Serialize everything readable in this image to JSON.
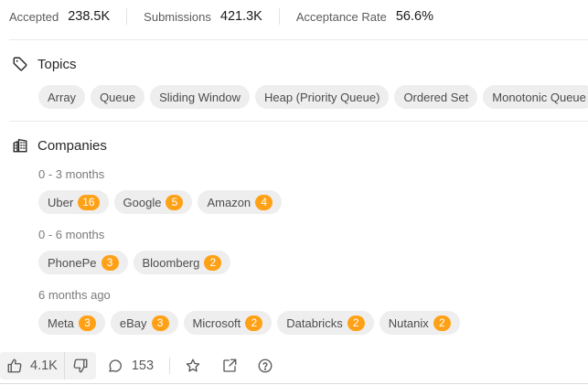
{
  "stats": [
    {
      "label": "Accepted",
      "value": "238.5K"
    },
    {
      "label": "Submissions",
      "value": "421.3K"
    },
    {
      "label": "Acceptance Rate",
      "value": "56.6%"
    }
  ],
  "topics": {
    "title": "Topics",
    "icon": "tag-icon",
    "tags": [
      "Array",
      "Queue",
      "Sliding Window",
      "Heap (Priority Queue)",
      "Ordered Set",
      "Monotonic Queue"
    ]
  },
  "companies": {
    "title": "Companies",
    "icon": "building-icon",
    "groups": [
      {
        "period": "0 - 3 months",
        "items": [
          {
            "name": "Uber",
            "count": "16"
          },
          {
            "name": "Google",
            "count": "5"
          },
          {
            "name": "Amazon",
            "count": "4"
          }
        ]
      },
      {
        "period": "0 - 6 months",
        "items": [
          {
            "name": "PhonePe",
            "count": "3"
          },
          {
            "name": "Bloomberg",
            "count": "2"
          }
        ]
      },
      {
        "period": "6 months ago",
        "items": [
          {
            "name": "Meta",
            "count": "3"
          },
          {
            "name": "eBay",
            "count": "3"
          },
          {
            "name": "Microsoft",
            "count": "2"
          },
          {
            "name": "Databricks",
            "count": "2"
          },
          {
            "name": "Nutanix",
            "count": "2"
          }
        ]
      }
    ]
  },
  "actions": {
    "likes": "4.1K",
    "comments": "153"
  },
  "colors": {
    "badge": "#ffa116",
    "chip": "#eeeeee"
  }
}
